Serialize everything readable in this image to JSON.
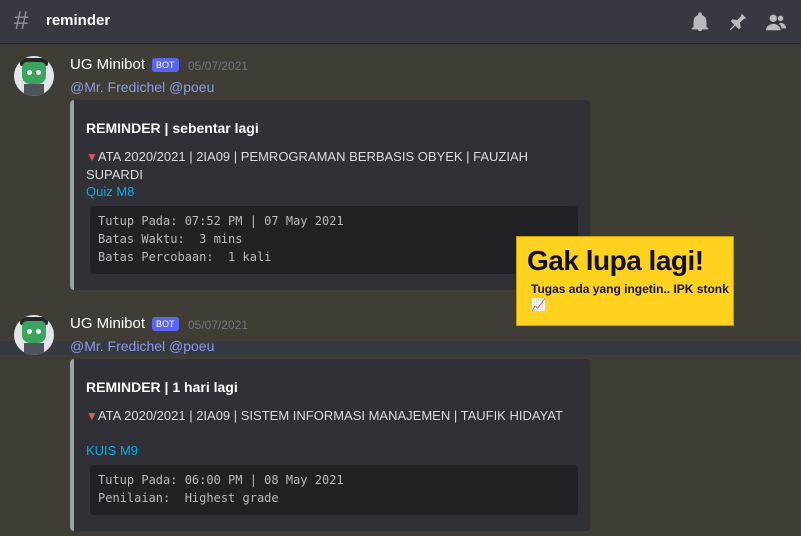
{
  "channel": {
    "name": "reminder"
  },
  "messages": [
    {
      "username": "UG Minibot",
      "tag": "BOT",
      "timestamp": "05/07/2021",
      "mentions": "@Mr. Fredichel @poeu",
      "embed": {
        "title": "REMINDER | sebentar lagi",
        "description": "ATA 2020/2021 | 2IA09 | PEMROGRAMAN BERBASIS OBYEK | FAUZIAH SUPARDI",
        "link": "Quiz M8",
        "code_lines": [
          "Tutup Pada: 07:52 PM | 07 May 2021",
          "Batas Waktu:  3 mins",
          "Batas Percobaan:  1 kali"
        ]
      }
    },
    {
      "username": "UG Minibot",
      "tag": "BOT",
      "timestamp": "05/07/2021",
      "mentions": "@Mr. Fredichel @poeu",
      "embed": {
        "title": "REMINDER | 1 hari lagi",
        "description": "ATA 2020/2021 | 2IA09 | SISTEM INFORMASI MANAJEMEN | TAUFIK HIDAYAT",
        "link": "KUIS M9",
        "code_lines": [
          "Tutup Pada: 06:00 PM | 08 May 2021",
          "Penilaian:  Highest grade"
        ]
      }
    }
  ],
  "promo": {
    "headline": "Gak lupa lagi!",
    "subtext": "Tugas ada yang ingetin.. IPK stonk 📈"
  },
  "icons": [
    "hash-icon",
    "bell-icon",
    "pin-icon",
    "members-icon",
    "red-triangle-icon"
  ],
  "colors": {
    "accent": "#5865f2",
    "link": "#00aff4",
    "mention": "#8c9ae6",
    "promo": "#ffd21f",
    "triangle": "#e0555a"
  }
}
